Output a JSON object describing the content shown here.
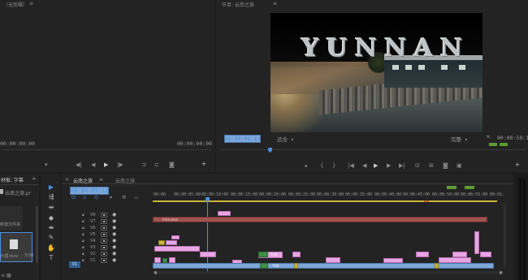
{
  "source_monitor": {
    "title": "（无剪辑）",
    "timecode_left": "00:00:00:00",
    "timecode_right": "00:00:00:00"
  },
  "program_monitor": {
    "title": "节目: 云南之旅",
    "video_title": "YUNNAN",
    "timecode": "00:00:09:12",
    "fit": "适合",
    "quality": "完整",
    "duration": "00:00:59:14"
  },
  "project_panel": {
    "tab_label": "材板: 字幕",
    "item_label": "云南之旅.pr",
    "file_label": "新建文件夹",
    "file_label2": "大理.mov",
    "size_label": "3:00"
  },
  "timeline": {
    "close_glyph": "×",
    "tab_label": "云南之旅",
    "tab2_label": "云南之旅",
    "timecode": "00:00:09:12",
    "ruler_labels": [
      "00:00",
      "00:00:05:00",
      "00:00:10:00",
      "00:00:15:00",
      "00:00:20:00",
      "00:00:25:00",
      "00:00:30:00",
      "00:00:35:00",
      "00:00:40:00",
      "00:00:45:00",
      "00:00:50:00",
      "00:00:55:00",
      "00:01:"
    ],
    "tracks": [
      "V8",
      "V7",
      "V6",
      "V5",
      "V4",
      "V3",
      "V2",
      "V1"
    ],
    "track_label_v1": "V1",
    "title_clip_label": "Intro.mov",
    "clip_label_1": "YUN",
    "clip_label_2": "YUN"
  },
  "icons": {
    "menu": "≡",
    "wrench": "🔧",
    "marker": "▼",
    "play": "▶",
    "step_back": "◀|",
    "step_fwd": "|▶",
    "go_in": "{",
    "go_out": "}",
    "camera": "📷",
    "export": "⊞",
    "plus": "+",
    "select_tool": "▶",
    "razor_tool": "◇",
    "hand_tool": "✋",
    "type_tool": "T"
  }
}
